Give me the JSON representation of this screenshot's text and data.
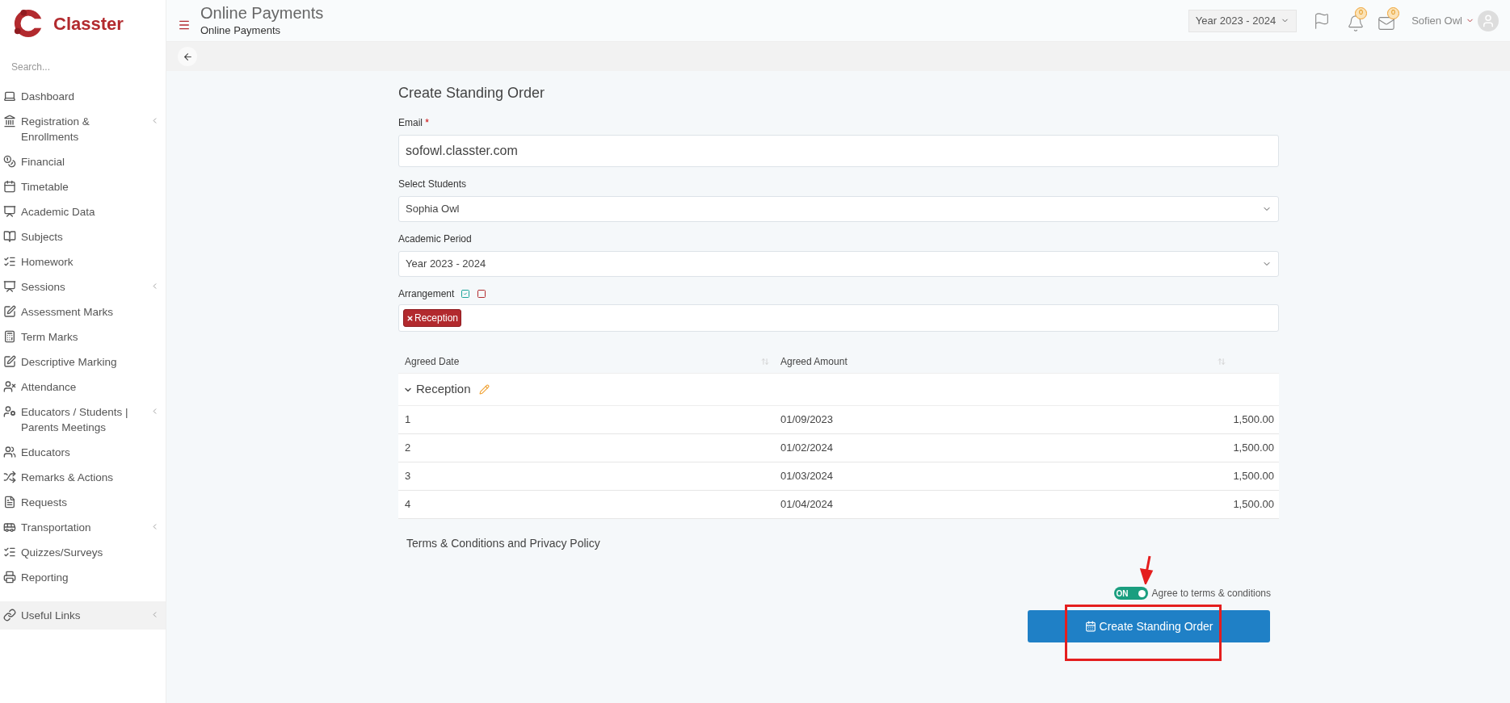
{
  "brand": {
    "name": "Classter"
  },
  "sidebar": {
    "search": {
      "placeholder": "Search..."
    },
    "items": [
      {
        "label": "Dashboard",
        "expandable": false
      },
      {
        "label": "Registration & Enrollments",
        "expandable": true
      },
      {
        "label": "Financial",
        "expandable": false
      },
      {
        "label": "Timetable",
        "expandable": false
      },
      {
        "label": "Academic Data",
        "expandable": false
      },
      {
        "label": "Subjects",
        "expandable": false
      },
      {
        "label": "Homework",
        "expandable": false
      },
      {
        "label": "Sessions",
        "expandable": true
      },
      {
        "label": "Assessment Marks",
        "expandable": false
      },
      {
        "label": "Term Marks",
        "expandable": false
      },
      {
        "label": "Descriptive Marking",
        "expandable": false
      },
      {
        "label": "Attendance",
        "expandable": false
      },
      {
        "label": "Educators / Students | Parents Meetings",
        "expandable": true
      },
      {
        "label": "Educators",
        "expandable": false
      },
      {
        "label": "Remarks & Actions",
        "expandable": false
      },
      {
        "label": "Requests",
        "expandable": false
      },
      {
        "label": "Transportation",
        "expandable": true
      },
      {
        "label": "Quizzes/Surveys",
        "expandable": false
      },
      {
        "label": "Reporting",
        "expandable": false
      }
    ],
    "footer_item": {
      "label": "Useful Links",
      "expandable": true
    }
  },
  "header": {
    "title": "Online Payments",
    "breadcrumb": "Online Payments",
    "year_selector": "Year 2023 - 2024",
    "notifications_count": "0",
    "messages_count": "0",
    "user_name": "Sofien Owl"
  },
  "form": {
    "title": "Create Standing Order",
    "email": {
      "label": "Email",
      "required_mark": "*",
      "value": "sofowl.classter.com"
    },
    "students": {
      "label": "Select Students",
      "value": "Sophia Owl"
    },
    "period": {
      "label": "Academic Period",
      "value": "Year 2023 - 2024"
    },
    "arrangement": {
      "label": "Arrangement",
      "tags": [
        "Reception"
      ]
    },
    "table": {
      "columns": [
        "Agreed Date",
        "Agreed Amount"
      ],
      "group": {
        "label": "Reception",
        "expanded": true
      },
      "rows": [
        {
          "index": "1",
          "date": "01/09/2023",
          "amount": "1,500.00"
        },
        {
          "index": "2",
          "date": "01/02/2024",
          "amount": "1,500.00"
        },
        {
          "index": "3",
          "date": "01/03/2024",
          "amount": "1,500.00"
        },
        {
          "index": "4",
          "date": "01/04/2024",
          "amount": "1,500.00"
        }
      ]
    },
    "terms_title": "Terms & Conditions and Privacy Policy",
    "agree_toggle": {
      "on": true,
      "state_label": "ON",
      "label": "Agree to terms & conditions"
    },
    "submit": "Create Standing Order"
  }
}
